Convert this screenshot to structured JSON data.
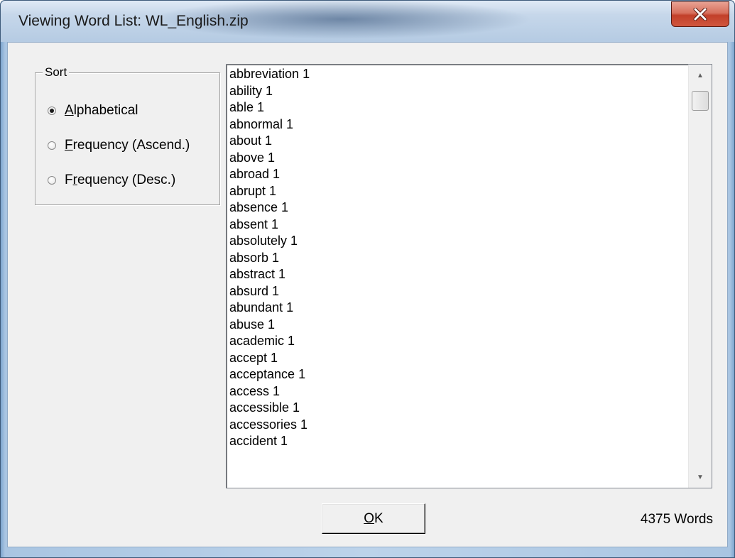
{
  "window": {
    "title": "Viewing Word List: WL_English.zip",
    "close_icon": "close-x-icon",
    "close_button_color": "#c2402a"
  },
  "sort_group": {
    "legend": "Sort",
    "options": [
      {
        "pre": "",
        "key": "A",
        "rest": "lphabetical",
        "checked": true
      },
      {
        "pre": "",
        "key": "F",
        "rest": "requency (Ascend.)",
        "checked": false
      },
      {
        "pre": "F",
        "key": "r",
        "rest": "equency (Desc.)",
        "checked": false
      }
    ]
  },
  "word_list": {
    "items": [
      "abbreviation 1",
      "ability 1",
      "able 1",
      "abnormal 1",
      "about 1",
      "above 1",
      "abroad 1",
      "abrupt 1",
      "absence 1",
      "absent 1",
      "absolutely 1",
      "absorb 1",
      "abstract 1",
      "absurd 1",
      "abundant 1",
      "abuse 1",
      "academic 1",
      "accept 1",
      "acceptance 1",
      "access 1",
      "accessible 1",
      "accessories 1",
      "accident 1"
    ],
    "scroll_up_icon": "scroll-up-arrow-icon",
    "scroll_down_icon": "scroll-down-arrow-icon",
    "scroll_position": 0.0
  },
  "footer": {
    "ok_key": "O",
    "ok_rest": "K",
    "word_count": "4375 Words"
  }
}
